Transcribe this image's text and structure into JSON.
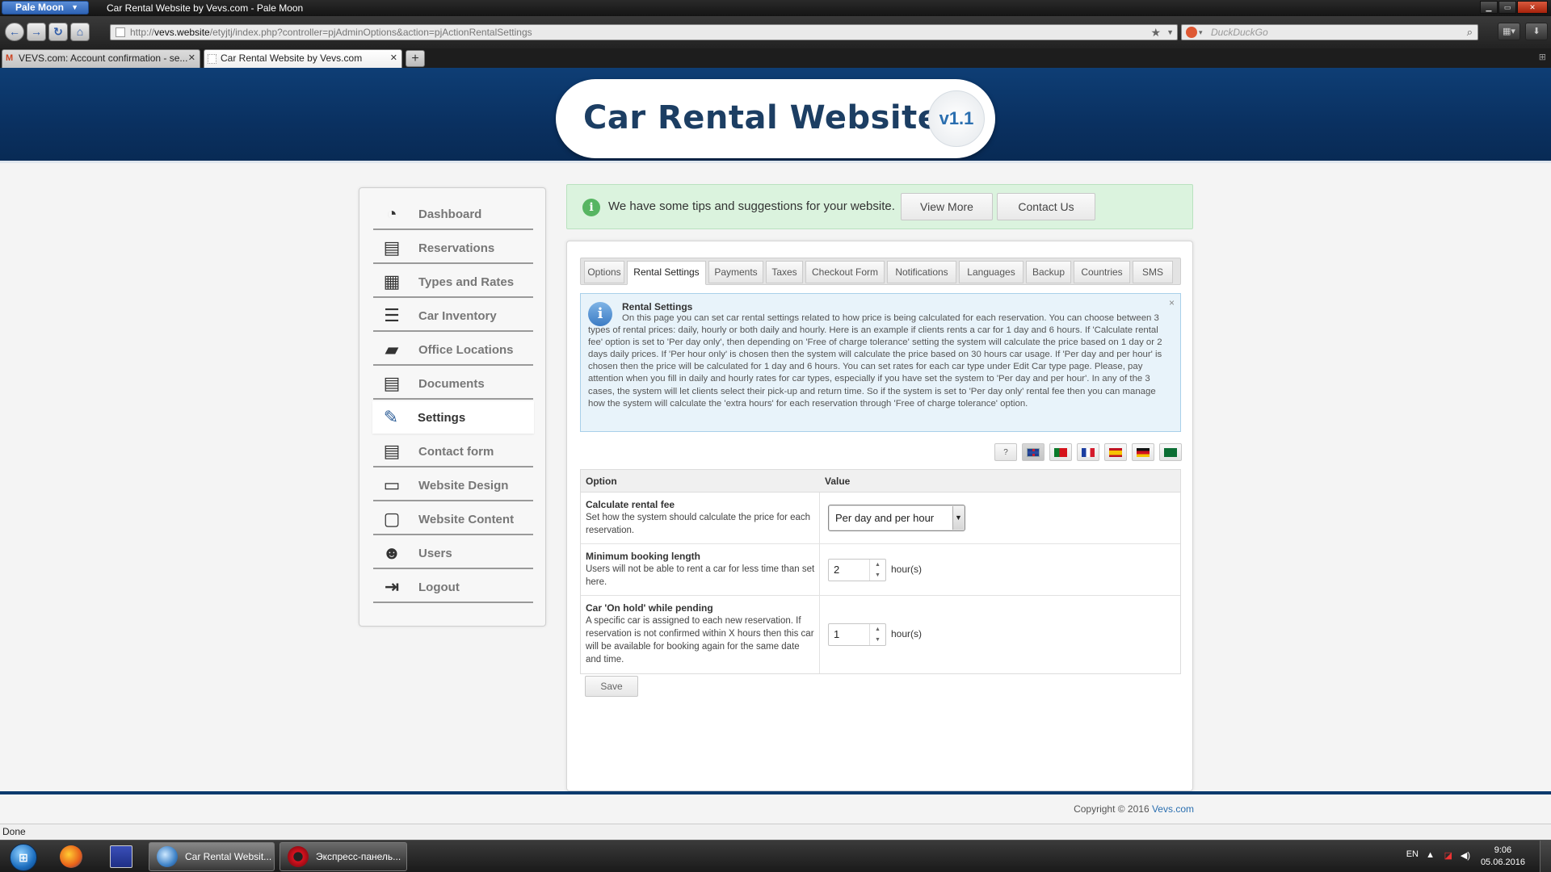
{
  "window": {
    "app_menu": "Pale Moon",
    "title": "Car Rental Website by Vevs.com - Pale Moon"
  },
  "browser": {
    "url_prefix": "http://",
    "url_domain": "vevs.website",
    "url_rest": "/etyjtj/index.php?controller=pjAdminOptions&action=pjActionRentalSettings",
    "search_placeholder": "DuckDuckGo",
    "tabs": [
      {
        "label": "VEVS.com: Account confirmation - se...",
        "favicon": "M"
      },
      {
        "label": "Car Rental Website by Vevs.com",
        "favicon": ""
      }
    ],
    "new_tab": "+",
    "status": "Done"
  },
  "header": {
    "logo_text": "Car Rental Website",
    "version": "v1.1"
  },
  "sidebar": {
    "items": [
      {
        "label": "Dashboard",
        "icon": "◔"
      },
      {
        "label": "Reservations",
        "icon": "▤"
      },
      {
        "label": "Types and Rates",
        "icon": "▦"
      },
      {
        "label": "Car Inventory",
        "icon": "☰"
      },
      {
        "label": "Office Locations",
        "icon": "▰"
      },
      {
        "label": "Documents",
        "icon": "▤"
      },
      {
        "label": "Settings",
        "icon": "✎"
      },
      {
        "label": "Contact form",
        "icon": "▤"
      },
      {
        "label": "Website Design",
        "icon": "▭"
      },
      {
        "label": "Website Content",
        "icon": "▢"
      },
      {
        "label": "Users",
        "icon": "☻"
      },
      {
        "label": "Logout",
        "icon": "⇥"
      }
    ],
    "active": "Settings"
  },
  "tips": {
    "icon": "i",
    "text": "We have some tips and suggestions for your website.",
    "view_more": "View More",
    "contact_us": "Contact Us"
  },
  "settings_tabs": [
    "Options",
    "Rental Settings",
    "Payments",
    "Taxes",
    "Checkout Form",
    "Notifications",
    "Languages",
    "Backup",
    "Countries",
    "SMS"
  ],
  "active_tab": "Rental Settings",
  "info": {
    "icon": "i",
    "title": "Rental Settings",
    "body": "On this page you can set car rental settings related to how price is being calculated for each reservation. You can choose between 3 types of rental prices: daily, hourly or both daily and hourly. Here is an example if clients rents a car for 1 day and 6 hours. If 'Calculate rental fee' option is set to 'Per day only', then depending on 'Free of charge tolerance' setting the system will calculate the price based on 1 day or 2 days daily prices. If 'Per hour only' is chosen then the system will calculate the price based on 30 hours car usage. If 'Per day and per hour' is chosen then the price will be calculated for 1 day and 6 hours. You can set rates for each car type under Edit Car type page. Please, pay attention when you fill in daily and hourly rates for car types, especially if you have set the system to 'Per day and per hour'. In any of the 3 cases, the system will let clients select their pick-up and return time. So if the system is set to 'Per day only' rental fee then you can manage how the system will calculate the 'extra hours' for each reservation through 'Free of charge tolerance' option.",
    "close": "×"
  },
  "flags": {
    "help": "?",
    "languages": [
      "uk",
      "pt",
      "fr",
      "es",
      "de",
      "sa"
    ],
    "selected": "uk"
  },
  "table": {
    "col_option": "Option",
    "col_value": "Value",
    "rows": [
      {
        "name": "Calculate rental fee",
        "desc": "Set how the system should calculate the price for each reservation.",
        "select_value": "Per day and per hour"
      },
      {
        "name": "Minimum booking length",
        "desc": "Users will not be able to rent a car for less time than set here.",
        "value": "2",
        "unit": "hour(s)"
      },
      {
        "name": "Car 'On hold' while pending",
        "desc": "A specific car is assigned to each new reservation. If reservation is not confirmed within X hours then this car will be available for booking again for the same date and time.",
        "value": "1",
        "unit": "hour(s)"
      }
    ]
  },
  "save_label": "Save",
  "footer": {
    "copyright": "Copyright © 2016",
    "link": "Vevs.com"
  },
  "taskbar": {
    "tasks": [
      {
        "label": "Car Rental Websit..."
      },
      {
        "label": "Экспресс-панель..."
      }
    ],
    "lang": "EN",
    "time": "9:06",
    "date": "05.06.2016"
  },
  "colors": {
    "header_blue": "#0a3060",
    "logo_text": "#1c3e63",
    "tips_bg": "#dbf3de",
    "info_bg": "#e8f3fa",
    "link": "#2b6fb0"
  }
}
